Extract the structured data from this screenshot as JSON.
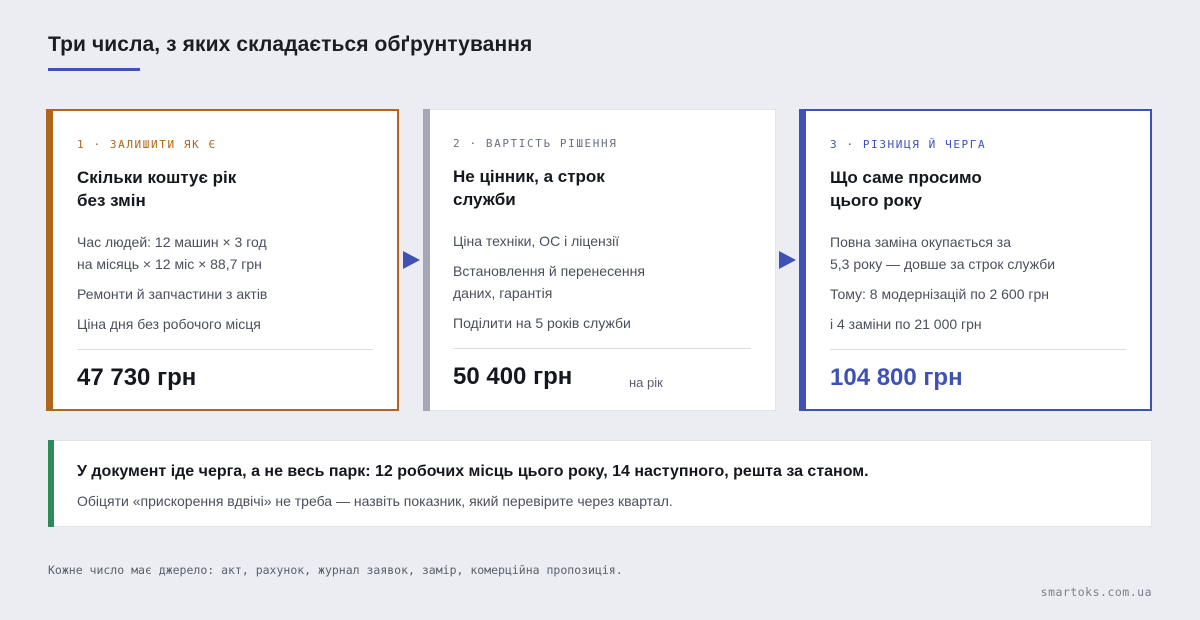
{
  "title": "Три числа, з яких складається обґрунтування",
  "colors": {
    "accent": "#3f51b5",
    "card1": "#b0651d",
    "card2": "#a4a8b6",
    "callout": "#2e8b57"
  },
  "cards": [
    {
      "eyebrow": "1 · ЗАЛИШИТИ ЯК Є",
      "heading_line1": "Скільки коштує рік",
      "heading_line2": "без змін",
      "lines": [
        "Час людей: 12 машин × 3 год",
        "на місяць × 12 міс × 88,7 грн",
        "Ремонти й запчастини з актів",
        "Ціна дня без робочого місця"
      ],
      "total": "47 730 грн"
    },
    {
      "eyebrow": "2 · ВАРТІСТЬ РІШЕННЯ",
      "heading_line1": "Не цінник, а строк",
      "heading_line2": "служби",
      "lines": [
        "Ціна техніки, ОС і ліцензії",
        "Встановлення й перенесення",
        "даних, гарантія",
        "Поділити на 5 років служби"
      ],
      "total": "50 400 грн",
      "note": "на рік"
    },
    {
      "eyebrow": "3 · РІЗНИЦЯ Й ЧЕРГА",
      "heading_line1": "Що саме просимо",
      "heading_line2": "цього року",
      "lines": [
        "Повна заміна окупається за",
        "5,3 року — довше за строк служби",
        "Тому: 8 модернізацій по 2 600 грн",
        "і 4 заміни по 21 000 грн"
      ],
      "total": "104 800 грн"
    }
  ],
  "callout": {
    "headline": "У документ іде черга, а не весь парк: 12 робочих місць цього року, 14 наступного, решта за станом.",
    "sub": "Обіцяти «прискорення вдвічі» не треба — назвіть показник, який перевірите через квартал."
  },
  "footnote": "Кожне число має джерело: акт, рахунок, журнал заявок, замір, комерційна пропозиція.",
  "site": "smartoks.com.ua"
}
